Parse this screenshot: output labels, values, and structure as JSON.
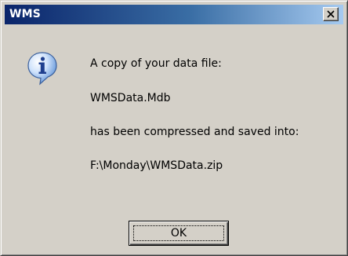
{
  "dialog": {
    "title": "WMS",
    "icon": "info-icon",
    "message_lines": [
      "A copy of your data file:",
      "WMSData.Mdb",
      "has been compressed and saved into:",
      "F:\\Monday\\WMSData.zip"
    ],
    "ok_label": "OK"
  },
  "colors": {
    "titlebar_start": "#0a246a",
    "titlebar_end": "#a6caf0",
    "face": "#d4d0c8"
  }
}
